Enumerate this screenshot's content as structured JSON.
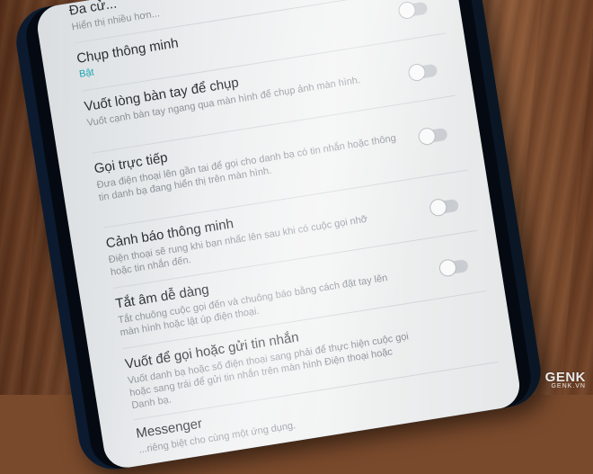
{
  "settings": {
    "items": [
      {
        "title": "Đa cử...",
        "desc": "Hiển thị nhiều hơn..."
      },
      {
        "title": "Chụp thông minh",
        "status": "Bật",
        "toggle_on": false
      },
      {
        "title": "Vuốt lòng bàn tay để chụp",
        "desc": "Vuốt cạnh bàn tay ngang qua màn hình để chụp ảnh màn hình.",
        "toggle_on": false
      },
      {
        "title": "Gọi trực tiếp",
        "desc": "Đưa điện thoại lên gần tai để gọi cho danh bạ có tin nhắn hoặc thông tin danh bạ đang hiển thị trên màn hình.",
        "toggle_on": false
      },
      {
        "title": "Cảnh báo thông minh",
        "desc": "Điện thoại sẽ rung khi bạn nhấc lên sau khi có cuộc gọi nhỡ hoặc tin nhắn đến.",
        "toggle_on": false
      },
      {
        "title": "Tắt âm dễ dàng",
        "desc": "Tắt chuông cuộc gọi đến và chuông báo bằng cách đặt tay lên màn hình hoặc lật úp điện thoại.",
        "toggle_on": false
      },
      {
        "title": "Vuốt để gọi hoặc gửi tin nhắn",
        "desc": "Vuốt danh bạ hoặc số điện thoại sang phải để thực hiện cuộc gọi hoặc sang trái để gửi tin nhắn trên màn hình Điện thoại hoặc Danh bạ."
      },
      {
        "title": "Messenger",
        "desc": "...riêng biệt cho cùng một ứng dụng."
      }
    ]
  },
  "watermark": {
    "brand": "GENK",
    "sub": "GENK.VN"
  }
}
